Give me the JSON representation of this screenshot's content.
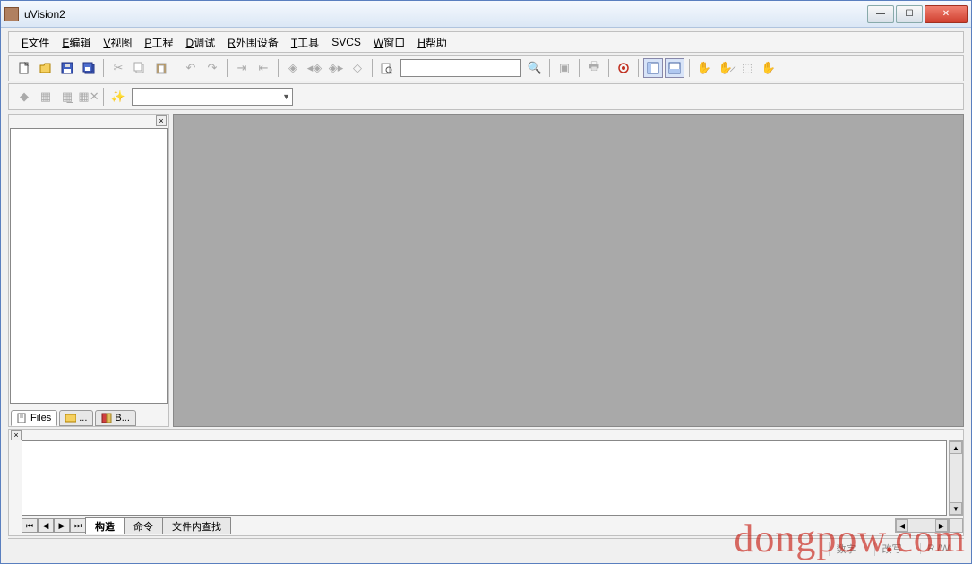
{
  "window": {
    "title": "uVision2"
  },
  "menus": {
    "file": {
      "u": "F",
      "label": "文件"
    },
    "edit": {
      "u": "E",
      "label": "编辑"
    },
    "view": {
      "u": "V",
      "label": "视图"
    },
    "project": {
      "u": "P",
      "label": "工程"
    },
    "debug": {
      "u": "D",
      "label": "调试"
    },
    "periph": {
      "u": "R",
      "label": "外围设备"
    },
    "tools": {
      "u": "T",
      "label": "工具"
    },
    "svcs": {
      "u": "",
      "label": "SVCS"
    },
    "window": {
      "u": "W",
      "label": "窗口"
    },
    "help": {
      "u": "H",
      "label": "帮助"
    }
  },
  "left_tabs": {
    "files": "Files",
    "regs": "...",
    "books": "B..."
  },
  "output_tabs": {
    "build": "构造",
    "command": "命令",
    "find": "文件内查找"
  },
  "status": {
    "num": "数字",
    "ovr": "改写",
    "rw": "R /W"
  },
  "watermark": {
    "a": "dongpow",
    "b": ".",
    "c": "com"
  }
}
